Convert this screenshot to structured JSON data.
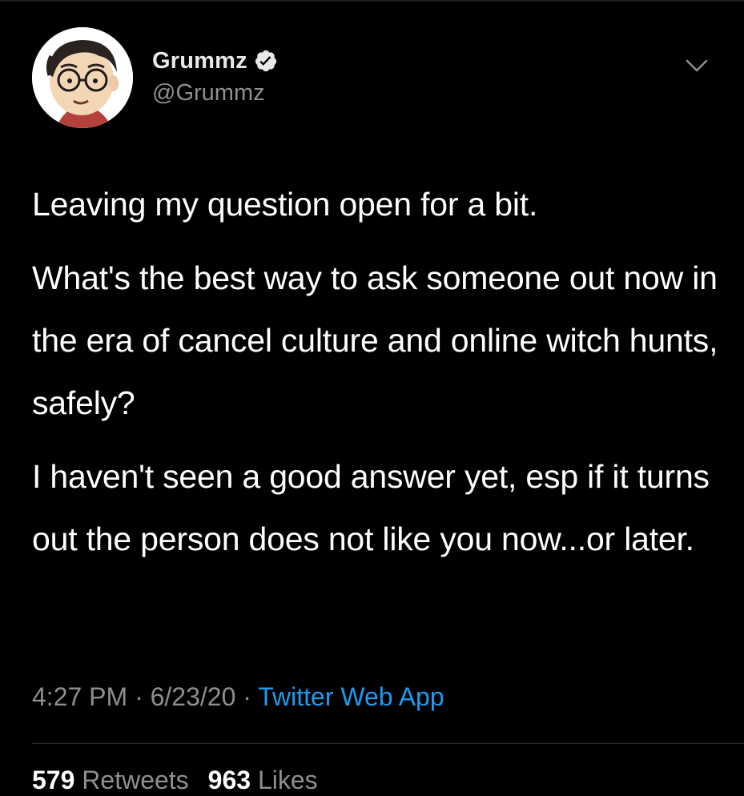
{
  "author": {
    "display_name": "Grummz",
    "handle": "@Grummz",
    "verified": true,
    "avatar_icon": "avatar-cartoon-face-with-glasses"
  },
  "tweet": {
    "paragraphs": [
      "Leaving my question open for a bit.",
      "What's the best way to ask someone out now in the era of cancel culture and online witch hunts, safely?",
      "I haven't seen a good answer yet, esp if it turns out the person does not like you now...or later."
    ]
  },
  "meta": {
    "time": "4:27 PM",
    "sep1": " · ",
    "date": "6/23/20",
    "sep2": " · ",
    "source": "Twitter Web App"
  },
  "stats": {
    "retweets_count": "579",
    "retweets_label": "Retweets",
    "likes_count": "963",
    "likes_label": "Likes"
  },
  "colors": {
    "background": "#000000",
    "text_primary": "#ffffff",
    "text_secondary": "#8e8e93",
    "link": "#1d9bf0",
    "verified_badge": "#e9e9e9"
  },
  "icons": {
    "verified": "verified-badge-icon",
    "menu": "chevron-down-icon"
  }
}
